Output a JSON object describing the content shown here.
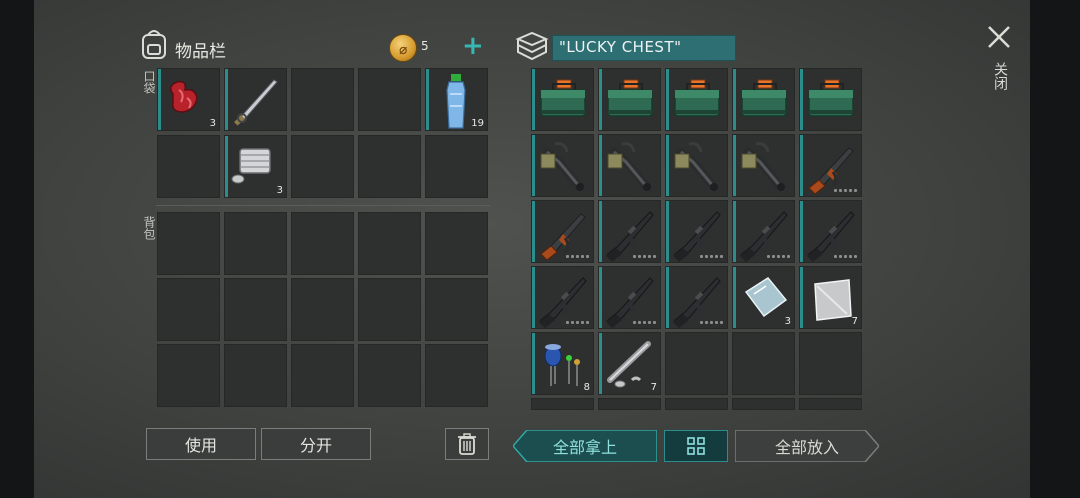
{
  "inventory": {
    "title": "物品栏",
    "coins": "5",
    "pocket_label": "口袋",
    "backpack_label": "背包",
    "pocket_slots": [
      {
        "item": "raw-meat-icon",
        "qty": "3"
      },
      {
        "item": "katana-icon",
        "qty": ""
      },
      {
        "item": "empty",
        "qty": ""
      },
      {
        "item": "empty",
        "qty": ""
      },
      {
        "item": "water-bottle-icon",
        "qty": "19"
      },
      {
        "item": "empty",
        "qty": ""
      },
      {
        "item": "engine-part-icon",
        "qty": "3"
      },
      {
        "item": "empty",
        "qty": ""
      },
      {
        "item": "empty",
        "qty": ""
      },
      {
        "item": "empty",
        "qty": ""
      }
    ],
    "backpack_slot_count": 15
  },
  "chest": {
    "name": "\"LUCKY CHEST\"",
    "slots": [
      {
        "item": "ammo-box-icon",
        "qty": ""
      },
      {
        "item": "ammo-box-icon",
        "qty": ""
      },
      {
        "item": "ammo-box-icon",
        "qty": ""
      },
      {
        "item": "ammo-box-icon",
        "qty": ""
      },
      {
        "item": "ammo-box-icon",
        "qty": ""
      },
      {
        "item": "grenade-launcher-icon",
        "qty": ""
      },
      {
        "item": "grenade-launcher-icon",
        "qty": ""
      },
      {
        "item": "grenade-launcher-icon",
        "qty": ""
      },
      {
        "item": "grenade-launcher-icon",
        "qty": ""
      },
      {
        "item": "ak-rifle-icon",
        "qty": "",
        "durability": 5
      },
      {
        "item": "ak-rifle-icon",
        "qty": "",
        "durability": 5
      },
      {
        "item": "m16-rifle-icon",
        "qty": "",
        "durability": 5
      },
      {
        "item": "m16-rifle-icon",
        "qty": "",
        "durability": 5
      },
      {
        "item": "m16-rifle-icon",
        "qty": "",
        "durability": 5
      },
      {
        "item": "m16-rifle-icon",
        "qty": "",
        "durability": 5
      },
      {
        "item": "m16-rifle-icon",
        "qty": "",
        "durability": 5
      },
      {
        "item": "m16-rifle-icon",
        "qty": "",
        "durability": 5
      },
      {
        "item": "m16-rifle-icon",
        "qty": "",
        "durability": 5
      },
      {
        "item": "glass-sheet-icon",
        "qty": "3"
      },
      {
        "item": "metal-plate-icon",
        "qty": "7"
      },
      {
        "item": "electronic-parts-icon",
        "qty": "8"
      },
      {
        "item": "pipe-parts-icon",
        "qty": "7"
      },
      {
        "item": "empty",
        "qty": ""
      },
      {
        "item": "empty",
        "qty": ""
      },
      {
        "item": "empty",
        "qty": ""
      }
    ]
  },
  "buttons": {
    "use": "使用",
    "split": "分开",
    "take_all": "全部拿上",
    "put_all": "全部放入",
    "close": "关闭"
  },
  "colors": {
    "accent_teal": "#2b8e8c",
    "slot_bg": "#2d302f",
    "panel_bg": "#434643"
  }
}
